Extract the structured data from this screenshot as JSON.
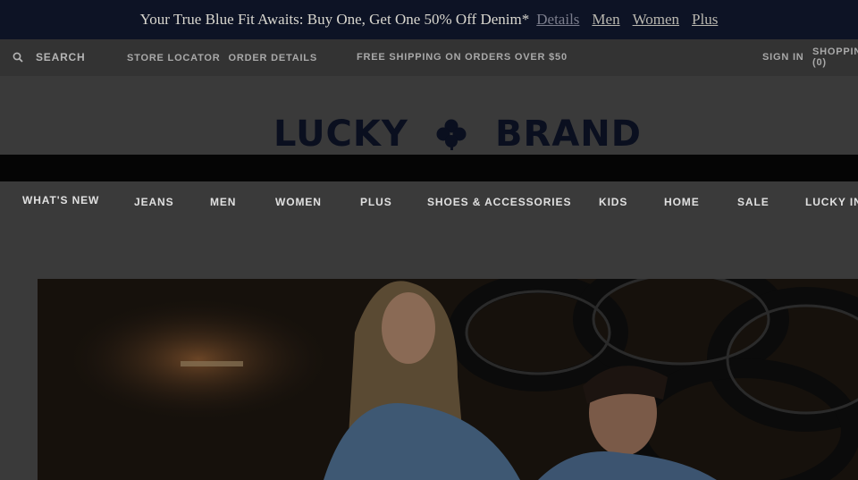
{
  "promo": {
    "message": "Your True Blue Fit Awaits: Buy One, Get One 50% Off Denim*",
    "details_link": "Details",
    "links": [
      "Men",
      "Women",
      "Plus"
    ]
  },
  "utility": {
    "search_label": "SEARCH",
    "store_locator": "STORE LOCATOR",
    "order_details": "ORDER DETAILS",
    "shipping_notice": "FREE SHIPPING ON ORDERS OVER $50",
    "sign_in": "SIGN IN",
    "bag_label": "SHOPPIN",
    "bag_count": "(0)"
  },
  "logo": {
    "left_word": "LUCKY",
    "right_word": "BRAND",
    "mark": "clover-icon",
    "color": "#0a0f1f"
  },
  "nav": {
    "items": [
      "WHAT'S NEW",
      "JEANS",
      "MEN",
      "WOMEN",
      "PLUS",
      "SHOES & ACCESSORIES",
      "KIDS",
      "HOME",
      "SALE",
      "LUCKY IN"
    ]
  },
  "colors": {
    "promo_bg": "#0d1325",
    "overlay": "#3a3a3a"
  }
}
